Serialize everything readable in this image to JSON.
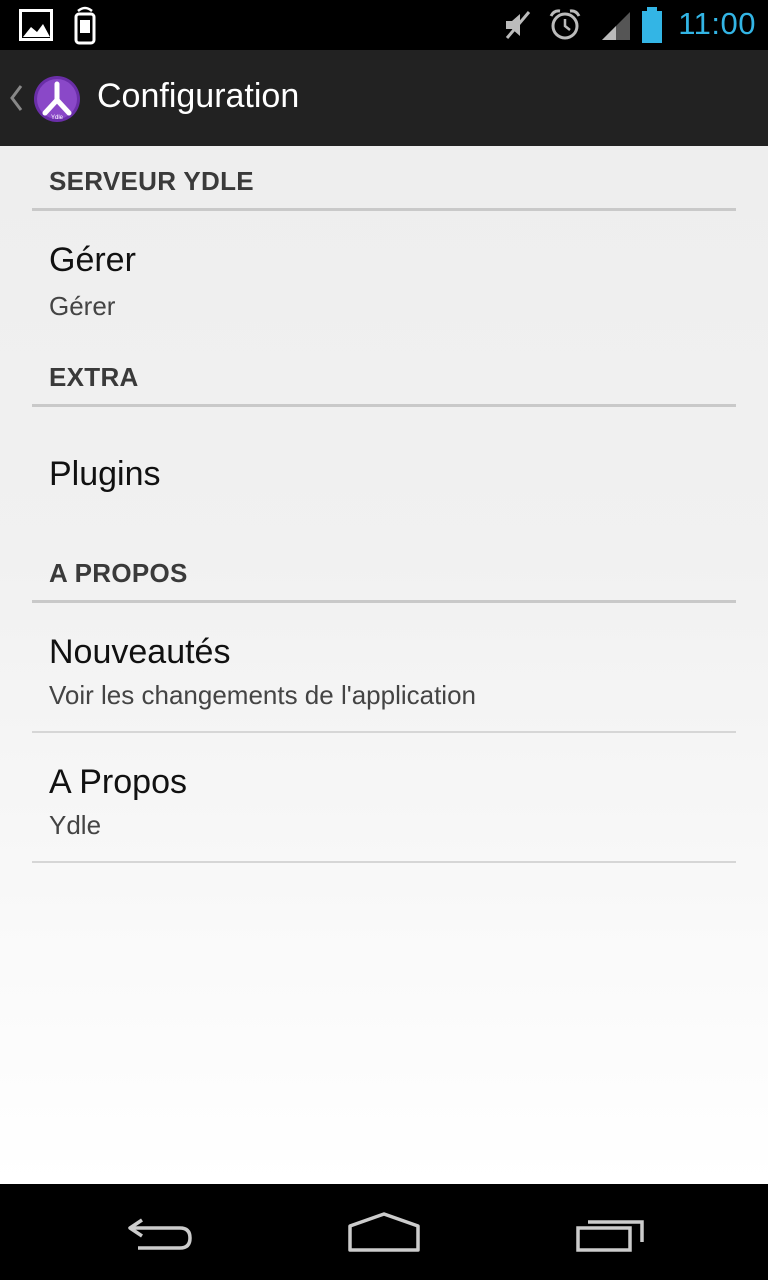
{
  "status_bar": {
    "time": "11:00",
    "icons": [
      "image-icon",
      "phone-vibrate-icon",
      "mute-icon",
      "alarm-icon",
      "signal-icon",
      "battery-icon"
    ],
    "time_color": "#33b5e5"
  },
  "action_bar": {
    "title": "Configuration",
    "logo_text": "Ydle",
    "logo_color": "#7b3fb8"
  },
  "categories": {
    "server": "SERVEUR YDLE",
    "extra": "EXTRA",
    "about": "A PROPOS"
  },
  "preferences": {
    "manage": {
      "title": "Gérer",
      "summary": "Gérer"
    },
    "plugins": {
      "title": "Plugins"
    },
    "news": {
      "title": "Nouveautés",
      "summary": "Voir les changements de l'application"
    },
    "about": {
      "title": "A Propos",
      "summary": "Ydle"
    }
  },
  "nav_bar": {
    "buttons": [
      "back-icon",
      "home-icon",
      "recent-apps-icon"
    ]
  }
}
